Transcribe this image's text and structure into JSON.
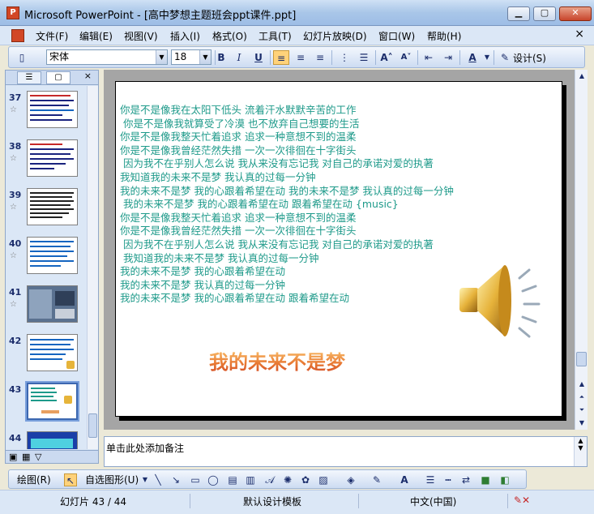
{
  "window": {
    "title": "Microsoft PowerPoint - [高中梦想主题班会ppt课件.ppt]",
    "app_icon_letter": "P",
    "minimize": "▁",
    "maximize": "▢",
    "close": "✕"
  },
  "menu": {
    "items": [
      "文件(F)",
      "编辑(E)",
      "视图(V)",
      "插入(I)",
      "格式(O)",
      "工具(T)",
      "幻灯片放映(D)",
      "窗口(W)",
      "帮助(H)"
    ],
    "close_doc": "×"
  },
  "toolbar": {
    "font_name": "宋体",
    "font_size": "18",
    "bold": "B",
    "italic": "I",
    "underline": "U",
    "design_label": "设计(S)"
  },
  "left_panel": {
    "close": "×",
    "thumbnails": [
      {
        "number": "37",
        "star": "☆"
      },
      {
        "number": "38",
        "star": "☆"
      },
      {
        "number": "39",
        "star": "☆"
      },
      {
        "number": "40",
        "star": "☆"
      },
      {
        "number": "41",
        "star": "☆"
      },
      {
        "number": "42",
        "star": ""
      },
      {
        "number": "43",
        "star": ""
      },
      {
        "number": "44",
        "star": ""
      }
    ],
    "selected": "43"
  },
  "slide": {
    "lyrics": [
      "你是不是像我在太阳下低头 流着汗水默默辛苦的工作",
      " 你是不是像我就算受了冷漠 也不放弃自己想要的生活",
      "你是不是像我整天忙着追求 追求一种意想不到的温柔",
      "你是不是像我曾经茫然失措 一次一次徘徊在十字街头",
      " 因为我不在乎别人怎么说 我从来没有忘记我 对自己的承诺对爱的执著",
      "我知道我的未来不是梦 我认真的过每一分钟",
      "我的未来不是梦 我的心跟着希望在动 我的未来不是梦 我认真的过每一分钟",
      " 我的未来不是梦 我的心跟着希望在动 跟着希望在动 {music}",
      "你是不是像我整天忙着追求 追求一种意想不到的温柔",
      "你是不是像我曾经茫然失措 一次一次徘徊在十字街头",
      " 因为我不在乎别人怎么说 我从来没有忘记我 对自己的承诺对爱的执著",
      " 我知道我的未来不是梦 我认真的过每一分钟",
      "我的未来不是梦 我的心跟着希望在动",
      "我的未来不是梦 我认真的过每一分钟",
      "我的未来不是梦 我的心跟着希望在动 跟着希望在动"
    ],
    "title": "我的未来不是梦"
  },
  "notes": {
    "placeholder": "单击此处添加备注"
  },
  "drawing_toolbar": {
    "draw_label": "绘图(R)",
    "autoshape_label": "自选图形(U)"
  },
  "status": {
    "slide_info": "幻灯片 43 / 44",
    "template": "默认设计模板",
    "language": "中文(中国)"
  },
  "colors": {
    "lyrics": "#1e9a8a",
    "title_gradient_top": "#ffd37a",
    "title_gradient_bottom": "#d24a25"
  }
}
